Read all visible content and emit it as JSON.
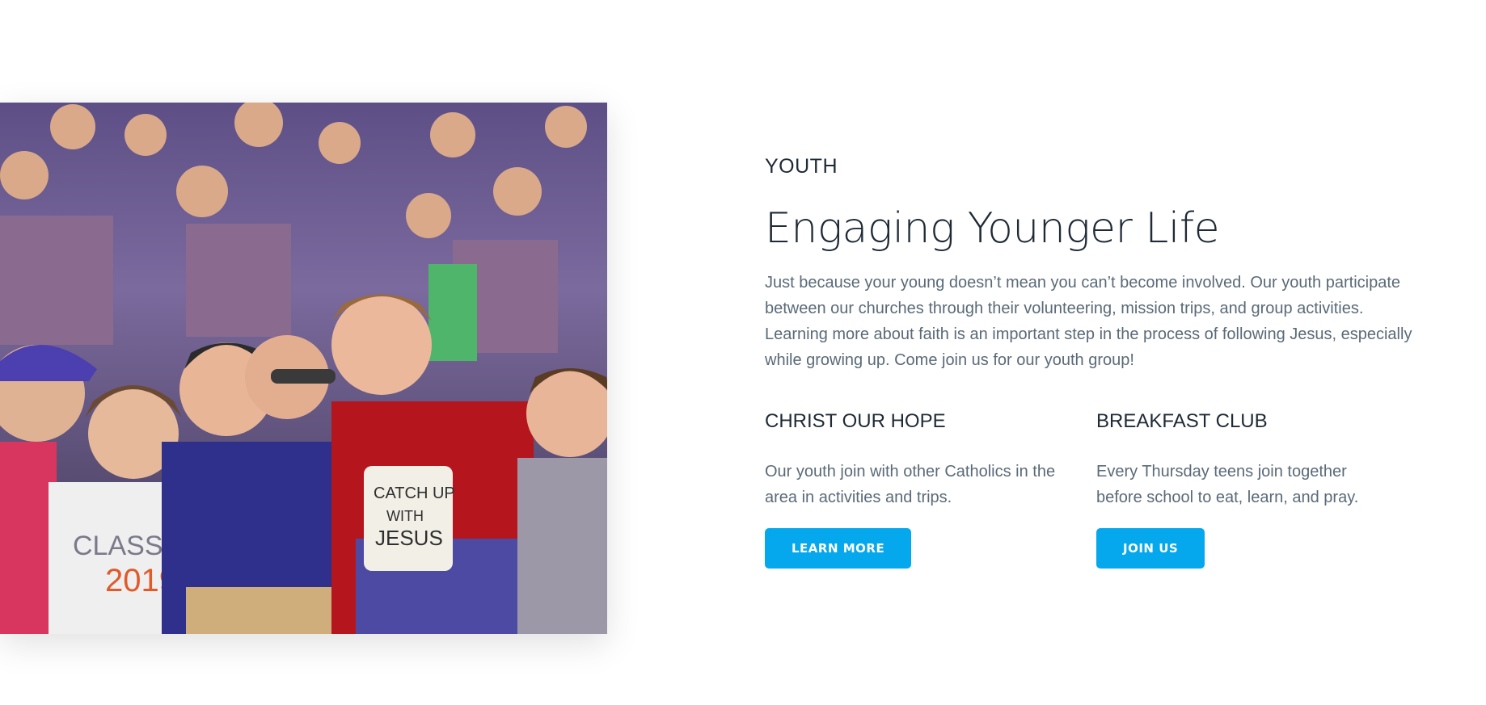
{
  "eyebrow": "YOUTH",
  "title": "Engaging Younger Life",
  "intro": "Just because your young doesn’t mean you can’t become involved. Our youth participate between our churches through their volunteering, mission trips, and group activities. Learning more about faith is an important step in the process of following Jesus, especially while growing up. Come join us for our youth group!",
  "columns": [
    {
      "title": "CHRIST OUR HOPE",
      "text": "Our youth join with other Catholics in the area in activities and trips.",
      "button": "LEARN MORE"
    },
    {
      "title": "BREAKFAST CLUB",
      "text": "Every Thursday teens join together before school to eat, learn, and pray.",
      "button": "JOIN US"
    }
  ],
  "colors": {
    "accent": "#05a8ec",
    "heading": "#1f2a36",
    "body_text": "#5a6a78"
  }
}
